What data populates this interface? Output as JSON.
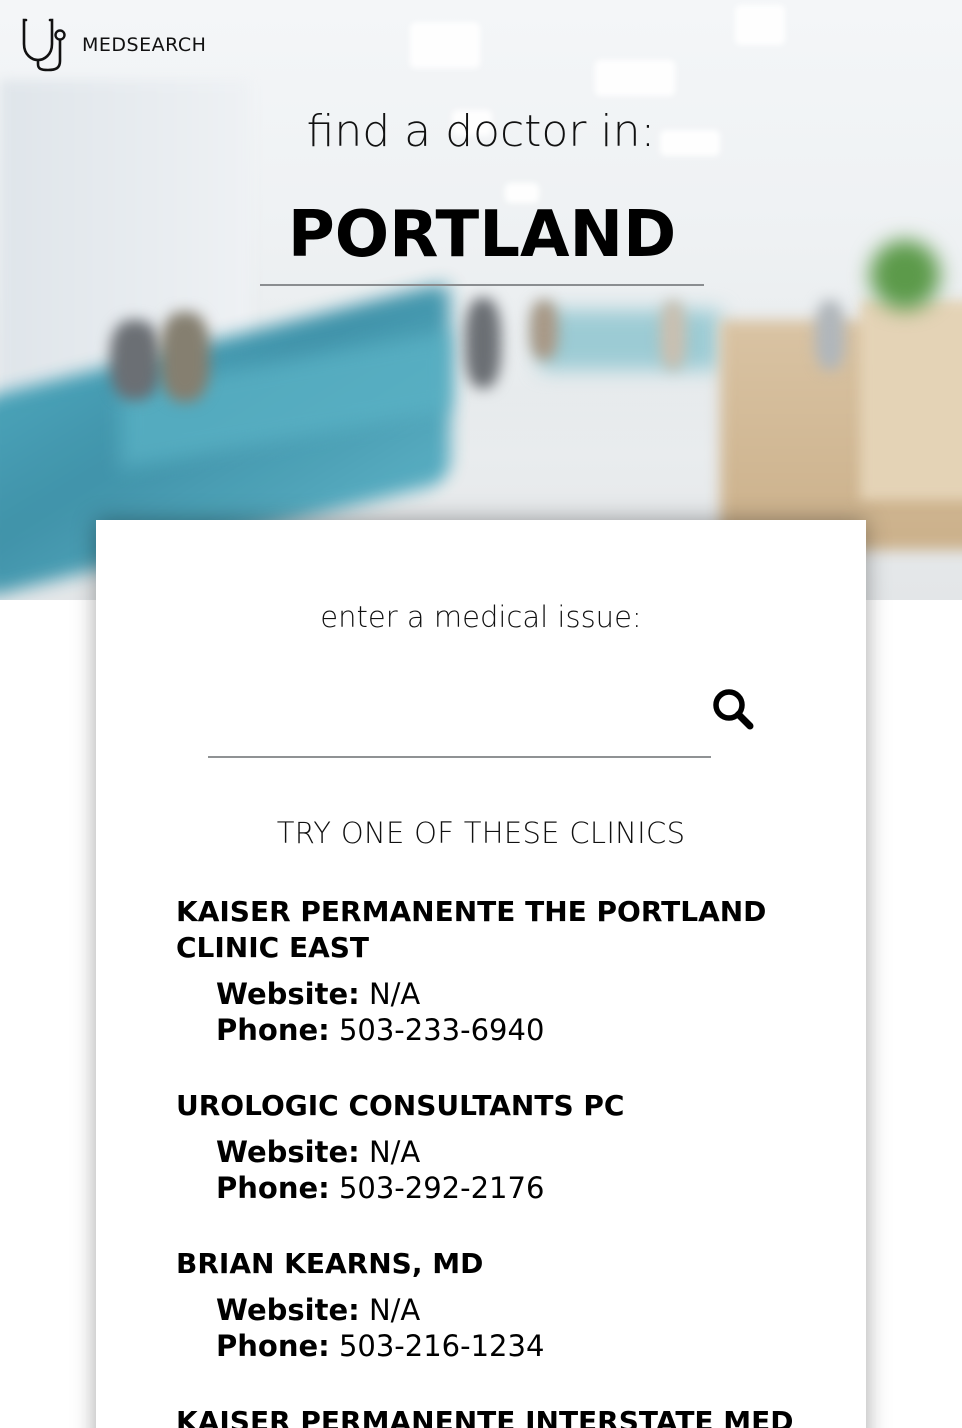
{
  "brand": {
    "name": "MEDSEARCH",
    "icon": "stethoscope-icon"
  },
  "hero": {
    "tagline": "find a doctor in:",
    "city_value": "PORTLAND"
  },
  "search": {
    "label": "enter a medical issue:",
    "value": "",
    "placeholder": "",
    "button_icon": "search-icon"
  },
  "clinics": {
    "heading": "TRY ONE OF THESE CLINICS",
    "website_label": "Website:",
    "phone_label": "Phone:",
    "items": [
      {
        "name": "KAISER PERMANENTE THE PORTLAND CLINIC EAST",
        "website": "N/A",
        "phone": "503-233-6940"
      },
      {
        "name": "UROLOGIC CONSULTANTS PC",
        "website": "N/A",
        "phone": "503-292-2176"
      },
      {
        "name": "BRIAN KEARNS, MD",
        "website": "N/A",
        "phone": "503-216-1234"
      },
      {
        "name": "KAISER PERMANENTE INTERSTATE MED"
      }
    ]
  },
  "colors": {
    "text": "#111111",
    "underline": "#8a8d90",
    "card_bg": "#ffffff",
    "seat_teal": "#3a9cb4"
  }
}
